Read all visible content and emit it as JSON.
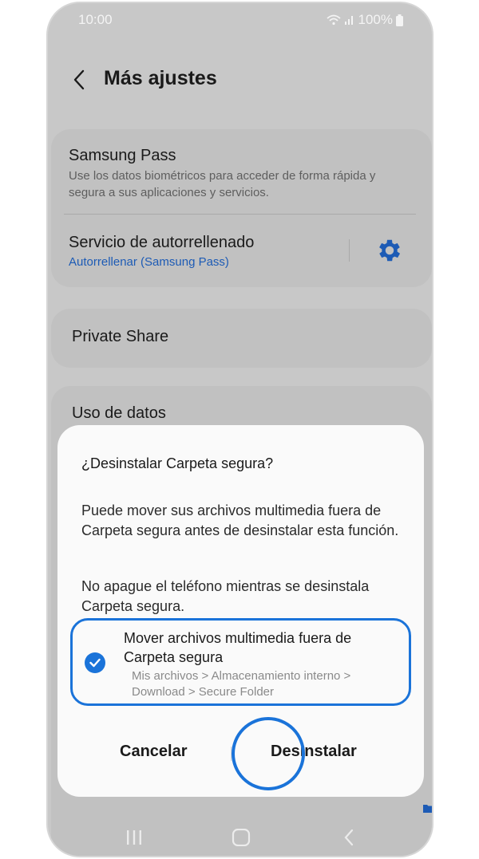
{
  "status_bar": {
    "time": "10:00",
    "battery": "100%"
  },
  "header": {
    "title": "Más ajustes"
  },
  "settings": {
    "samsung_pass": {
      "title": "Samsung Pass",
      "subtitle": "Use los datos biométricos para acceder de forma rápida y segura a sus aplicaciones y servicios."
    },
    "autofill": {
      "title": "Servicio de autorrellenado",
      "value": "Autorrellenar (Samsung Pass)"
    },
    "private_share": {
      "title": "Private Share"
    },
    "data_usage": {
      "title": "Uso de datos"
    }
  },
  "dialog": {
    "title": "¿Desinstalar Carpeta segura?",
    "body_1": "Puede mover sus archivos multimedia fuera de Carpeta segura antes de desinstalar esta función.",
    "body_2": "No apague el teléfono mientras se desinstala Carpeta segura.",
    "option": {
      "label": "Mover archivos multimedia fuera de Carpeta segura",
      "path": "Mis archivos > Almacenamiento interno > Download > Secure Folder",
      "checked": true
    },
    "cancel_label": "Cancelar",
    "uninstall_label": "Desinstalar"
  },
  "colors": {
    "accent": "#1a73d9",
    "link": "#1d5bb5"
  },
  "icons": [
    "back-arrow-icon",
    "gear-icon",
    "check-icon",
    "wifi-icon",
    "signal-icon",
    "battery-icon",
    "recents-icon",
    "home-icon",
    "nav-back-icon",
    "folder-icon"
  ]
}
